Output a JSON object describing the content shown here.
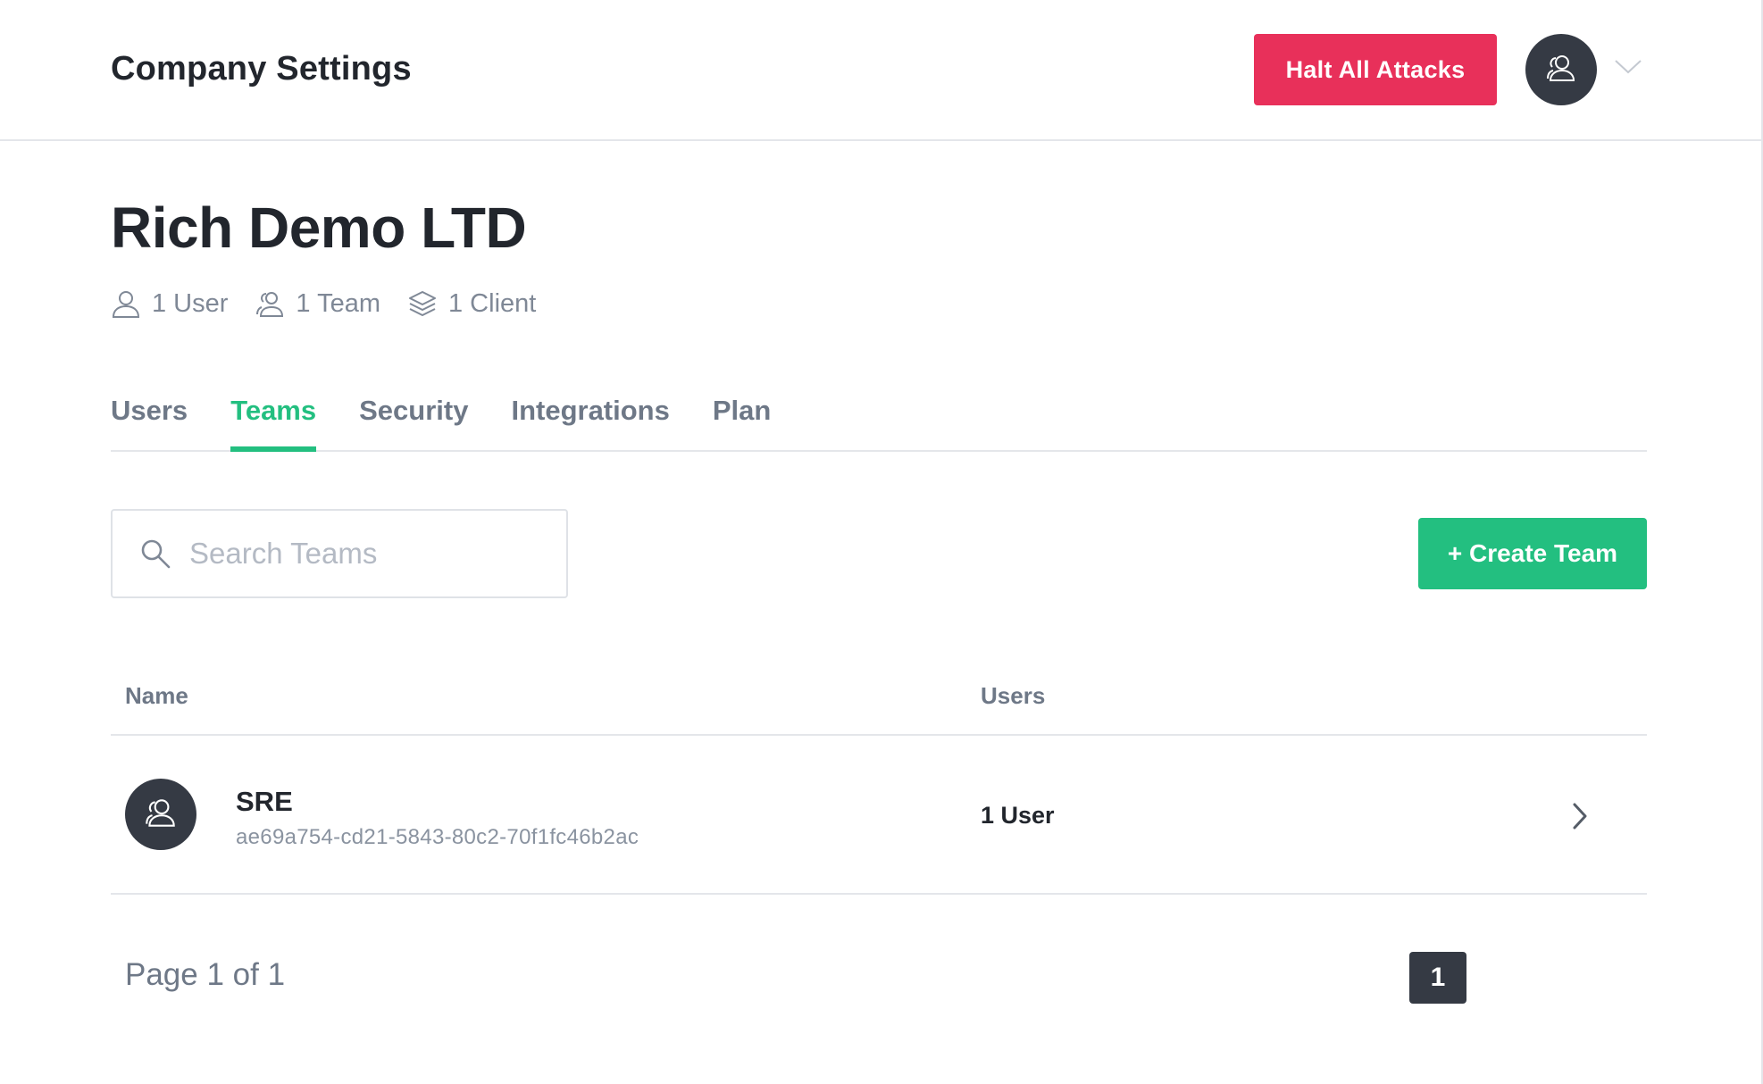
{
  "header": {
    "title": "Company Settings",
    "halt_label": "Halt All Attacks",
    "avatar_icon": "team-icon",
    "menu_icon": "chevron-down-icon"
  },
  "company": {
    "name": "Rich Demo LTD",
    "stats": [
      {
        "icon": "user-icon",
        "text": "1 User"
      },
      {
        "icon": "team-icon",
        "text": "1 Team"
      },
      {
        "icon": "layers-icon",
        "text": "1 Client"
      }
    ]
  },
  "tabs": [
    {
      "label": "Users",
      "active": false
    },
    {
      "label": "Teams",
      "active": true
    },
    {
      "label": "Security",
      "active": false
    },
    {
      "label": "Integrations",
      "active": false
    },
    {
      "label": "Plan",
      "active": false
    }
  ],
  "search": {
    "placeholder": "Search Teams",
    "value": ""
  },
  "create_label": "+ Create Team",
  "table": {
    "columns": [
      "Name",
      "Users"
    ],
    "rows": [
      {
        "name": "SRE",
        "id": "ae69a754-cd21-5843-80c2-70f1fc46b2ac",
        "users": "1 User"
      }
    ]
  },
  "pagination": {
    "label": "Page 1 of 1",
    "current": "1"
  },
  "colors": {
    "accent_green": "#23bf80",
    "danger_red": "#e8305a",
    "dark_avatar": "#353a44"
  }
}
